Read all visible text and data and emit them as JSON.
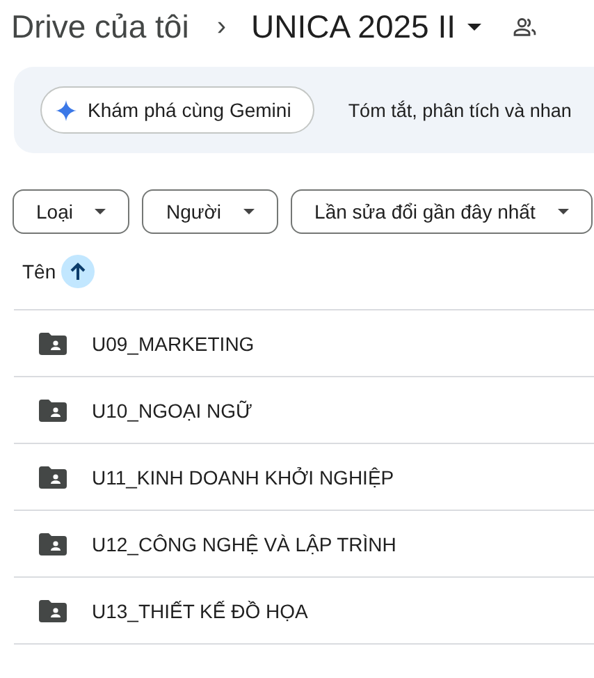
{
  "breadcrumb": {
    "parent": "Drive của tôi",
    "separator": "›",
    "current": "UNICA 2025 II"
  },
  "gemini": {
    "button": "Khám phá cùng Gemini",
    "text": "Tóm tắt, phân tích và nhan"
  },
  "filters": [
    {
      "label": "Loại"
    },
    {
      "label": "Người"
    },
    {
      "label": "Lần sửa đổi gần đây nhất"
    }
  ],
  "list_header": {
    "label": "Tên",
    "sort_ascending": true
  },
  "rows": [
    {
      "name": "U09_MARKETING",
      "kind": "shared-folder"
    },
    {
      "name": "U10_NGOẠI NGỮ",
      "kind": "shared-folder"
    },
    {
      "name": "U11_KINH DOANH KHỞI NGHIỆP",
      "kind": "shared-folder"
    },
    {
      "name": "U12_CÔNG NGHỆ VÀ LẬP TRÌNH",
      "kind": "shared-folder"
    },
    {
      "name": "U13_THIẾT KẾ ĐỒ HỌA",
      "kind": "shared-folder"
    }
  ]
}
